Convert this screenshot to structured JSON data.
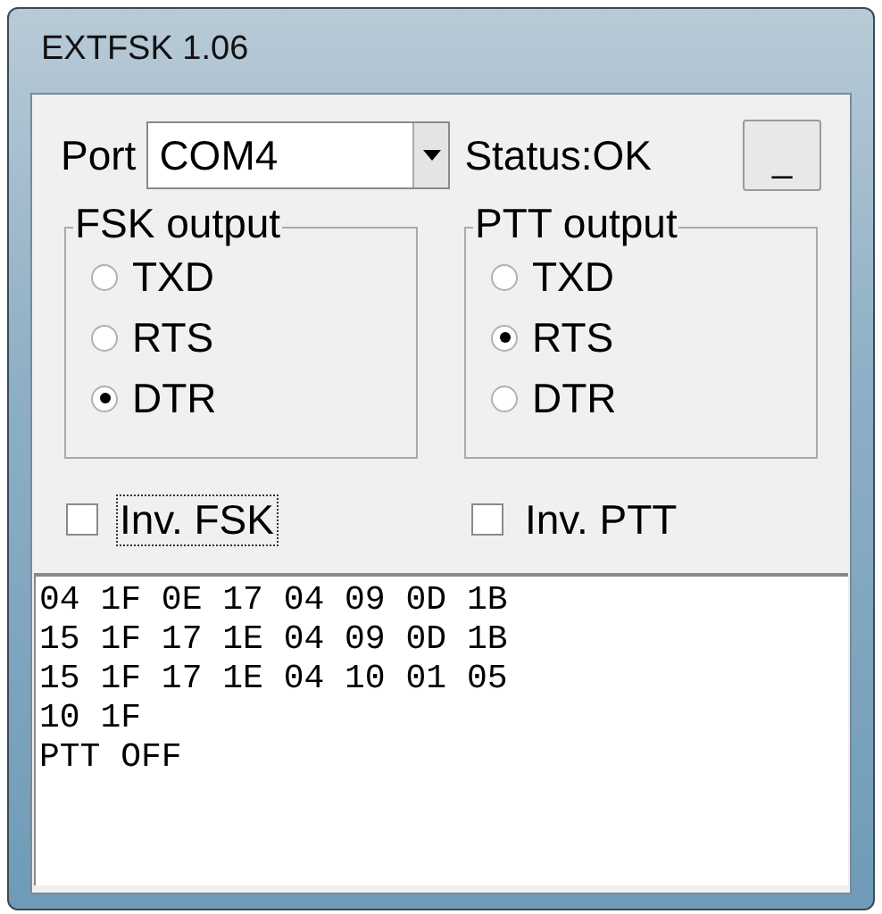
{
  "window": {
    "title": "EXTFSK 1.06"
  },
  "port": {
    "label": "Port",
    "value": "COM4"
  },
  "status": "Status:OK",
  "minimize_button": "_",
  "groups": [
    {
      "title": "FSK output",
      "options": [
        {
          "label": "TXD",
          "selected": false
        },
        {
          "label": "RTS",
          "selected": false
        },
        {
          "label": "DTR",
          "selected": true
        }
      ]
    },
    {
      "title": "PTT output",
      "options": [
        {
          "label": "TXD",
          "selected": false
        },
        {
          "label": "RTS",
          "selected": true
        },
        {
          "label": "DTR",
          "selected": false
        }
      ]
    }
  ],
  "checkboxes": [
    {
      "label": "Inv. FSK",
      "checked": false,
      "focused": true
    },
    {
      "label": "Inv. PTT",
      "checked": false,
      "focused": false
    }
  ],
  "log": [
    "04 1F 0E 17 04 09 0D 1B",
    "15 1F 17 1E 04 09 0D 1B",
    "15 1F 17 1E 04 10 01 05",
    "10 1F",
    "PTT OFF"
  ]
}
